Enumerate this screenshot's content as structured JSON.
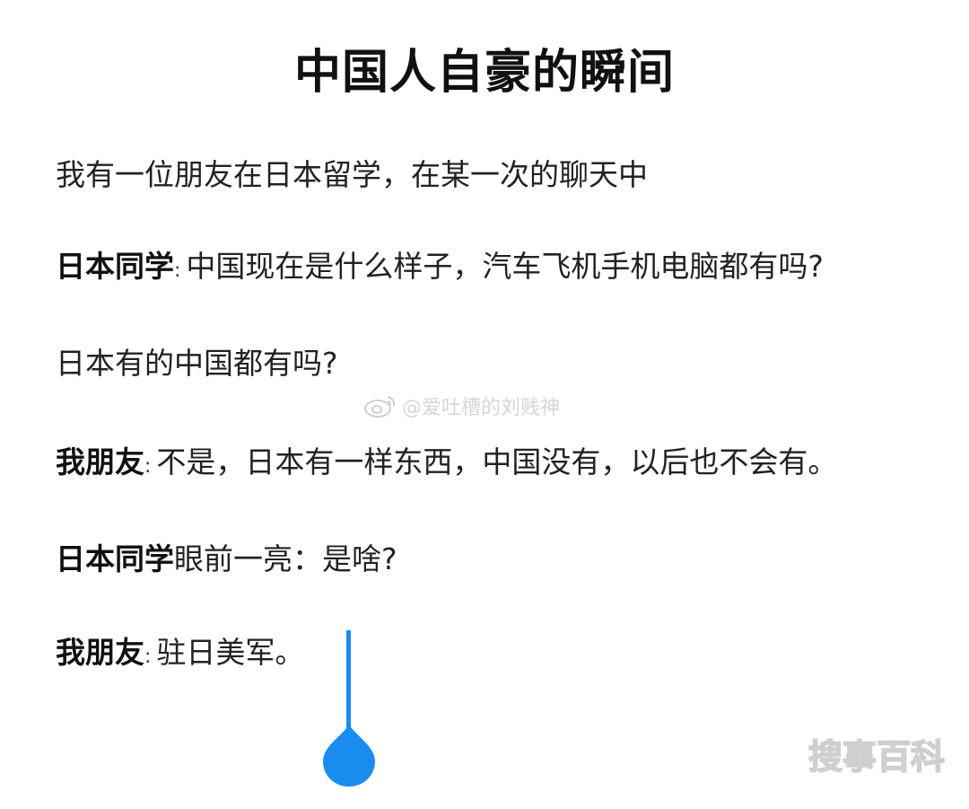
{
  "title": "中国人自豪的瞬间",
  "lines": [
    {
      "speaker": "",
      "colon": "",
      "text": "我有一位朋友在日本留学，在某一次的聊天中"
    },
    {
      "speaker": "日本同学",
      "colon": ":",
      "text": "中国现在是什么样子，汽车飞机手机电脑都有吗?"
    },
    {
      "speaker": "",
      "colon": "",
      "text": "日本有的中国都有吗?"
    },
    {
      "speaker": "我朋友",
      "colon": ":",
      "text": "不是，日本有一样东西，中国没有，以后也不会有。"
    },
    {
      "speaker": "日本同学",
      "colon": "",
      "text": "眼前一亮：是啥?"
    },
    {
      "speaker": "我朋友",
      "colon": ":",
      "text": "驻日美军。"
    }
  ],
  "watermark": {
    "text": "@爱吐槽的刘贱神",
    "icon": "weibo-icon"
  },
  "handle": {
    "color": "#1a8cf0",
    "icon": "text-cursor-handle-icon"
  },
  "corner_logo": {
    "text": "搜事百科"
  }
}
